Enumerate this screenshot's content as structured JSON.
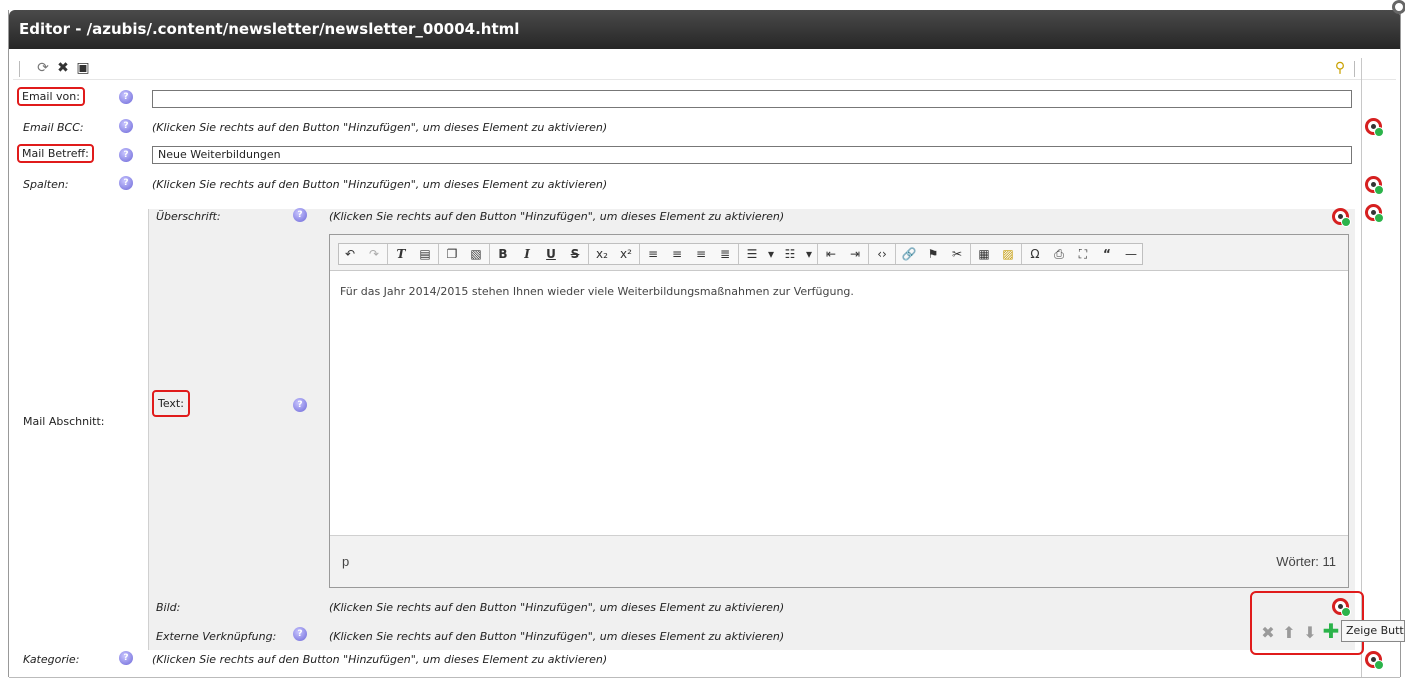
{
  "window": {
    "title": "Editor - /azubis/.content/newsletter/newsletter_00004.html"
  },
  "toolbar": {
    "icons": [
      "reload-icon",
      "delete-icon",
      "save-icon",
      "search-icon"
    ]
  },
  "fields": {
    "email_von": {
      "label": "Email von:",
      "value": ""
    },
    "email_bcc": {
      "label": "Email BCC:",
      "hint": "(Klicken Sie rechts auf den Button \"Hinzufügen\", um dieses Element zu aktivieren)"
    },
    "mail_betreff": {
      "label": "Mail Betreff:",
      "value": "Neue Weiterbildungen"
    },
    "spalten": {
      "label": "Spalten:",
      "hint": "(Klicken Sie rechts auf den Button \"Hinzufügen\", um dieses Element zu aktivieren)"
    },
    "mail_abschnitt": {
      "label": "Mail Abschnitt:"
    },
    "kategorie": {
      "label": "Kategorie:",
      "hint": "(Klicken Sie rechts auf den Button \"Hinzufügen\", um dieses Element zu aktivieren)"
    }
  },
  "section": {
    "ueberschrift": {
      "label": "Überschrift:",
      "hint": "(Klicken Sie rechts auf den Button \"Hinzufügen\", um dieses Element zu aktivieren)"
    },
    "text": {
      "label": "Text:"
    },
    "bild": {
      "label": "Bild:",
      "hint": "(Klicken Sie rechts auf den Button \"Hinzufügen\", um dieses Element zu aktivieren)"
    },
    "externe": {
      "label": "Externe Verknüpfung:",
      "hint": "(Klicken Sie rechts auf den Button \"Hinzufügen\", um dieses Element zu aktivieren)"
    }
  },
  "editor": {
    "content": "Für das Jahr 2014/2015 stehen Ihnen wieder viele Weiterbildungsmaßnahmen zur Verfügung.",
    "path": "p",
    "word_count": "Wörter: 11"
  },
  "help_glyph": "?",
  "tooltip": "Zeige Buttons",
  "colors": {
    "highlight": "#e01b1b",
    "title_bar": "#333333",
    "add_green": "#2bb34a"
  }
}
